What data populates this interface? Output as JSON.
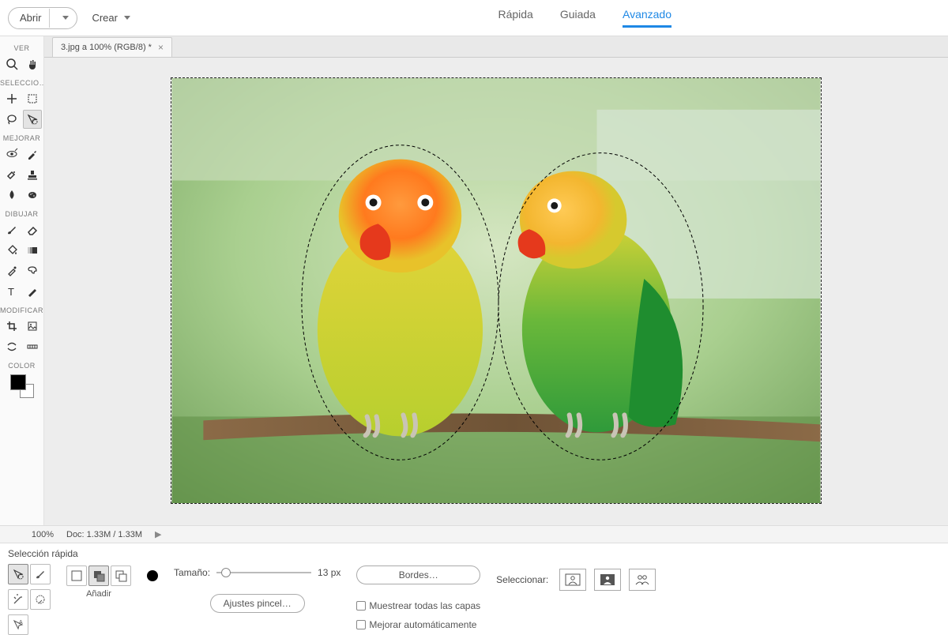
{
  "topbar": {
    "open": "Abrir",
    "create": "Crear"
  },
  "modes": {
    "quick": "Rápida",
    "guided": "Guiada",
    "expert": "Avanzado"
  },
  "sidebar": {
    "view": "VER",
    "select": "SELECCIO…",
    "enhance": "MEJORAR",
    "draw": "DIBUJAR",
    "modify": "MODIFICAR",
    "color": "COLOR"
  },
  "doc_tab": {
    "title": "3.jpg a 100% (RGB/8) *"
  },
  "status": {
    "zoom": "100%",
    "doc": "Doc: 1.33M / 1.33M"
  },
  "options": {
    "title": "Selección rápida",
    "add_label": "Añadir",
    "size_label": "Tamaño:",
    "size_value": "13 px",
    "brush_settings": "Ajustes pincel…",
    "edges": "Bordes…",
    "chk_sample": "Muestrear todas las capas",
    "chk_auto": "Mejorar automáticamente",
    "select_label": "Seleccionar:"
  }
}
